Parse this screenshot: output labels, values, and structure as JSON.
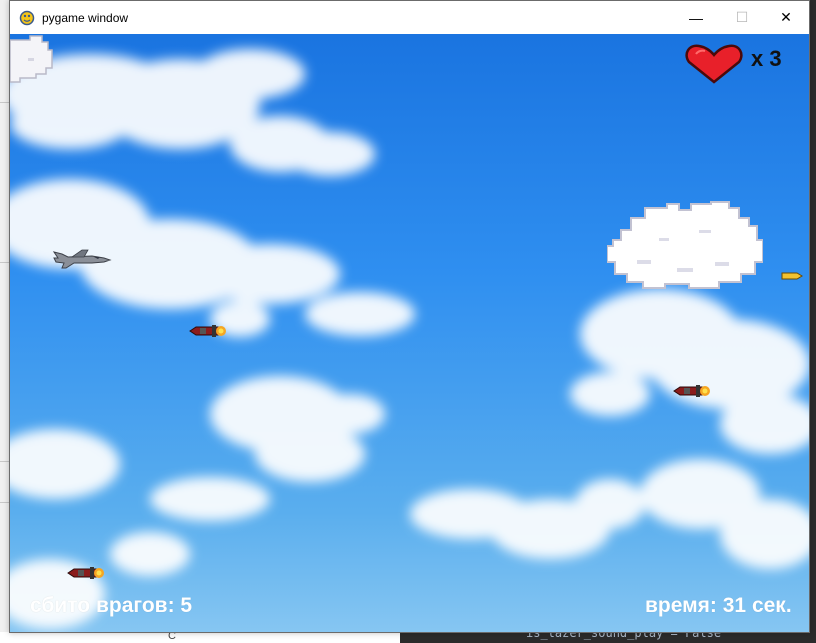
{
  "window": {
    "title": "pygame window",
    "minimize_label": "—",
    "maximize_label": "☐",
    "close_label": "✕"
  },
  "hud": {
    "lives_text": "x 3",
    "kills_text": "сбито врагов: 5",
    "time_text": "время: 31 сек."
  },
  "icons": {
    "app": "pygame-snake-icon",
    "lives": "heart-icon",
    "player": "jet-fighter-icon",
    "enemy": "missile-icon",
    "bullet": "bullet-icon"
  },
  "colors": {
    "sky_top": "#1a74e0",
    "sky_bottom": "#86c6f2",
    "heart": "#e8202a",
    "hud_text": "#ffffff",
    "missile_body": "#8b1c1c",
    "missile_flame": "#f5a623",
    "bullet": "#f2c230"
  },
  "background": {
    "code_text": "is_lazer_sound_play = False",
    "bottom_text": "С"
  }
}
